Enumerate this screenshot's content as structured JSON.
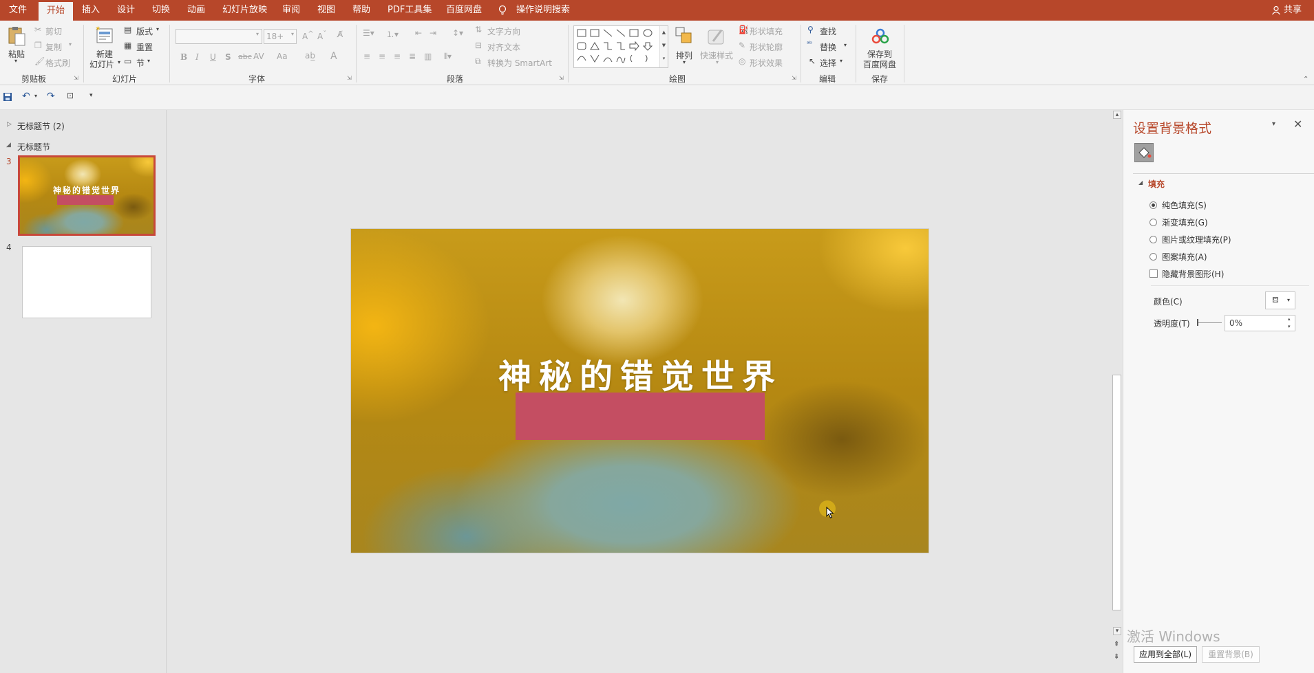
{
  "menu": {
    "tabs": [
      "文件",
      "开始",
      "插入",
      "设计",
      "切换",
      "动画",
      "幻灯片放映",
      "审阅",
      "视图",
      "帮助",
      "PDF工具集",
      "百度网盘"
    ],
    "active": "开始",
    "search": "操作说明搜索",
    "share": "共享"
  },
  "ribbon": {
    "clipboard": {
      "paste": "粘贴",
      "cut": "剪切",
      "copy": "复制",
      "format_painter": "格式刷",
      "label": "剪贴板"
    },
    "slides": {
      "new_slide_1": "新建",
      "new_slide_2": "幻灯片",
      "layout": "版式",
      "reset": "重置",
      "section": "节",
      "label": "幻灯片"
    },
    "font": {
      "size": "18+",
      "bold": "B",
      "italic": "I",
      "underline": "U",
      "shadow": "S",
      "strike": "abc",
      "spacing": "AV",
      "case": "Aa",
      "color": "A",
      "label": "字体"
    },
    "paragraph": {
      "text_direction": "文字方向",
      "align_text": "对齐文本",
      "smartart": "转换为 SmartArt",
      "label": "段落"
    },
    "drawing": {
      "arrange": "排列",
      "quick_styles": "快速样式",
      "shape_fill": "形状填充",
      "shape_outline": "形状轮廓",
      "shape_effects": "形状效果",
      "label": "绘图"
    },
    "editing": {
      "find": "查找",
      "replace": "替换",
      "select": "选择",
      "label": "编辑"
    },
    "save": {
      "line1": "保存到",
      "line2": "百度网盘",
      "label": "保存"
    }
  },
  "thumbnails": {
    "section1": "无标题节 (2)",
    "section2": "无标题节",
    "slides": [
      {
        "number": "3",
        "title": "神秘的错觉世界"
      },
      {
        "number": "4"
      }
    ]
  },
  "slide": {
    "title": "神秘的错觉世界"
  },
  "format_pane": {
    "title": "设置背景格式",
    "section": "填充",
    "options": [
      "纯色填充(S)",
      "渐变填充(G)",
      "图片或纹理填充(P)",
      "图案填充(A)"
    ],
    "selected": "纯色填充(S)",
    "hide_bg": "隐藏背景图形(H)",
    "color_label": "颜色(C)",
    "transparency_label": "透明度(T)",
    "transparency_value": "0%",
    "apply_all": "应用到全部(L)",
    "reset_bg": "重置背景(B)"
  },
  "watermark": {
    "line1": "激活 Windows"
  },
  "colors": {
    "accent": "#b7472a",
    "bar": "#c44e62"
  }
}
